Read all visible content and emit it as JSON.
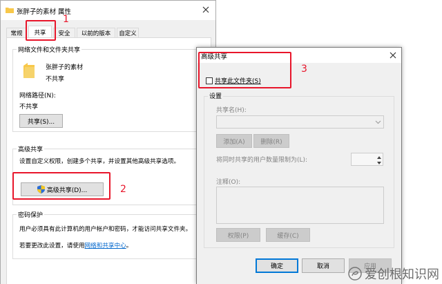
{
  "main_window": {
    "title": "张胖子的素材 属性",
    "tabs": [
      {
        "label": "常规"
      },
      {
        "label": "共享"
      },
      {
        "label": "安全"
      },
      {
        "label": "以前的版本"
      },
      {
        "label": "自定义"
      }
    ],
    "network_share_group": {
      "title": "网络文件和文件夹共享",
      "folder_name": "张胖子的素材",
      "folder_status": "不共享",
      "network_path_label": "网络路径(N):",
      "network_path_value": "不共享",
      "share_button": "共享(S)..."
    },
    "advanced_group": {
      "title": "高级共享",
      "description": "设置自定义权限，创建多个共享，并设置其他高级共享选项。",
      "advanced_button": "高级共享(D)..."
    },
    "password_group": {
      "title": "密码保护",
      "description": "用户必须具有此计算机的用户帐户和密码，才能访问共享文件夹。",
      "change_prefix": "若要更改此设置，请使用",
      "change_link": "网络和共享中心",
      "change_suffix": "。"
    }
  },
  "advanced_dialog": {
    "title": "高级共享",
    "share_checkbox_label": "共享此文件夹(S)",
    "share_checked": false,
    "settings_title": "设置",
    "share_name_label": "共享名(H):",
    "add_button": "添加(A)",
    "remove_button": "删除(R)",
    "limit_label": "将同时共享的用户数量限制为(L):",
    "comment_label": "注释(O):",
    "permissions_button": "权限(P)",
    "cache_button": "缓存(C)",
    "ok_button": "确定",
    "cancel_button": "取消",
    "apply_button": "应用"
  },
  "annotations": {
    "step1": "1",
    "step2": "2",
    "step3": "3"
  },
  "watermark": {
    "text": "爱创根知识网"
  },
  "colors": {
    "annotation_red": "#e8152a",
    "link_blue": "#0066cc",
    "focus_blue": "#0078d7",
    "folder_yellow": "#f8c84a"
  }
}
